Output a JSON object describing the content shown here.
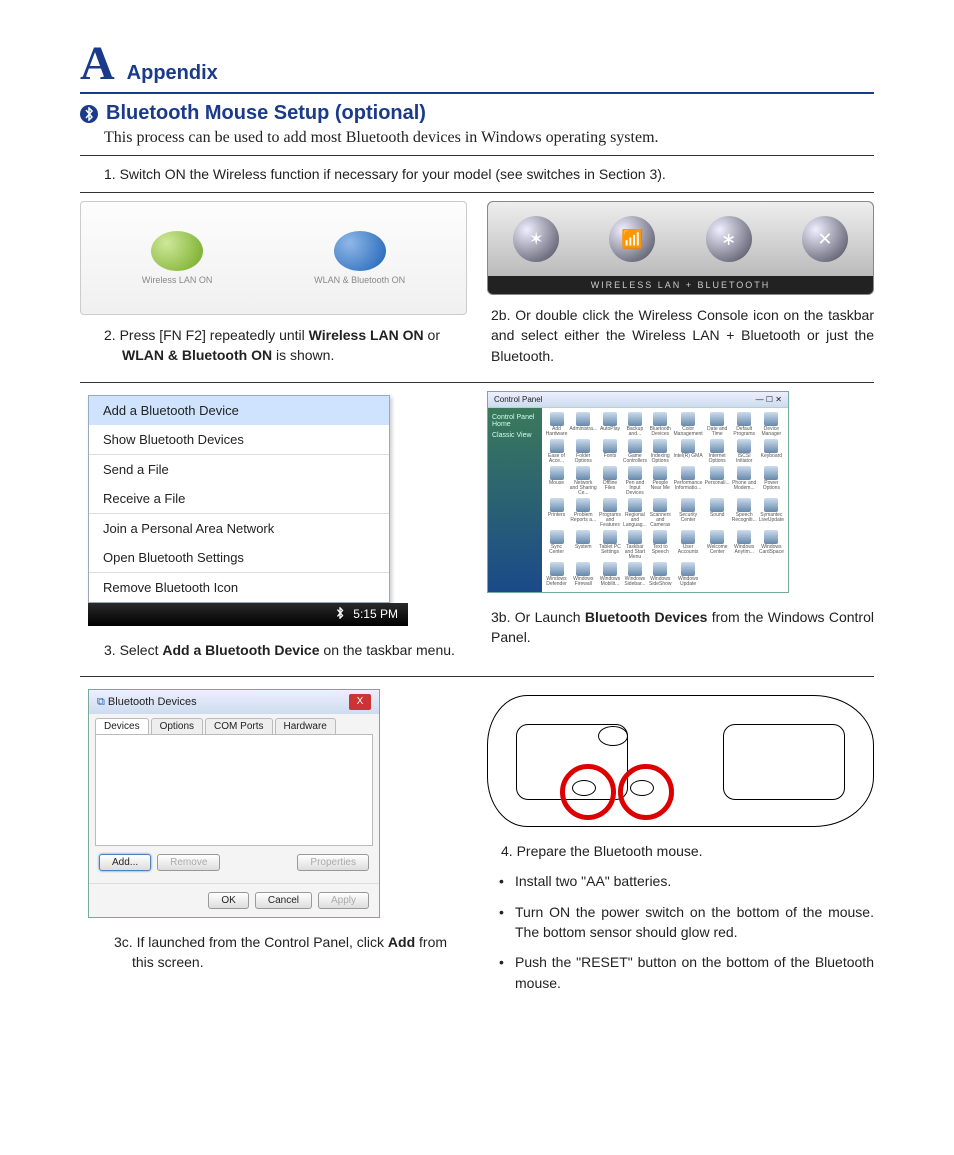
{
  "header": {
    "letter": "A",
    "label": "Appendix"
  },
  "section": {
    "title": "Bluetooth Mouse Setup (optional)",
    "intro": "This process can be used to add most Bluetooth devices in Windows operating system."
  },
  "step1": "1.   Switch ON the Wireless function if necessary for your model (see switches in Section 3).",
  "iconLabels": {
    "wlan": "Wireless LAN ON",
    "both": "WLAN & Bluetooth ON"
  },
  "radioStripLabel": "WIRELESS LAN + BLUETOOTH",
  "step2": {
    "prefix": "2.   Press [FN F2] repeatedly until ",
    "b1": "Wireless LAN ON",
    "mid": " or ",
    "b2": "WLAN & Bluetooth ON",
    "suffix": " is shown."
  },
  "step2b": "2b. Or double click the Wireless Console icon on the taskbar and select either the Wireless LAN + Bluetooth or just the Bluetooth.",
  "contextMenu": {
    "items": [
      "Add a Bluetooth Device",
      "Show Bluetooth Devices",
      "Send a File",
      "Receive a File",
      "Join a Personal Area Network",
      "Open Bluetooth Settings",
      "Remove Bluetooth Icon"
    ],
    "time": "5:15 PM"
  },
  "controlPanel": {
    "path": "Control Panel",
    "sideTitle": "Control Panel Home",
    "sideLink": "Classic View",
    "icons": [
      "Add Hardware",
      "Administra...",
      "AutoPlay",
      "Backup and...",
      "Bluetooth Devices",
      "Color Management",
      "Date and Time",
      "Default Programs",
      "Device Manager",
      "Ease of Acce...",
      "Folder Options",
      "Fonts",
      "Game Controllers",
      "Indexing Options",
      "Intel(R) GMA",
      "Internet Options",
      "iSCSI Initiator",
      "Keyboard",
      "Mouse",
      "Network and Sharing Ce...",
      "Offline Files",
      "Pen and Input Devices",
      "People Near Me",
      "Performance Informatio...",
      "Personali...",
      "Phone and Modem...",
      "Power Options",
      "Printers",
      "Problem Reports a...",
      "Programs and Features",
      "Regional and Languag...",
      "Scanners and Cameras",
      "Security Center",
      "Sound",
      "Speech Recogniti...",
      "Symantec LiveUpdate",
      "Sync Center",
      "System",
      "Tablet PC Settings",
      "Taskbar and Start Menu",
      "Text to Speech",
      "User Accounts",
      "Welcome Center",
      "Windows Anytim...",
      "Windows CardSpace",
      "Windows Defender",
      "Windows Firewall",
      "Windows Mobilit...",
      "Windows Sidebar...",
      "Windows SideShow",
      "Windows Update"
    ]
  },
  "step3": {
    "prefix": "3.   Select ",
    "b": "Add a Bluetooth Device",
    "suffix": " on the taskbar menu."
  },
  "step3b": {
    "prefix": "3b. Or Launch ",
    "b": "Bluetooth Devices",
    "suffix": " from the Windows Control Panel."
  },
  "dialog": {
    "title": "Bluetooth Devices",
    "tabs": [
      "Devices",
      "Options",
      "COM Ports",
      "Hardware"
    ],
    "buttons": {
      "add": "Add...",
      "remove": "Remove",
      "props": "Properties",
      "ok": "OK",
      "cancel": "Cancel",
      "apply": "Apply"
    }
  },
  "step3c": {
    "prefix": "3c. If launched from the Control Panel, click ",
    "b": "Add",
    "suffix": " from this screen."
  },
  "step4": "4.   Prepare the Bluetooth mouse.",
  "bullets": [
    "Install two \"AA\" batteries.",
    "Turn ON the power switch on the bottom of the mouse. The bottom sensor should glow red.",
    "Push the \"RESET\" button on the bottom of the Bluetooth mouse."
  ]
}
